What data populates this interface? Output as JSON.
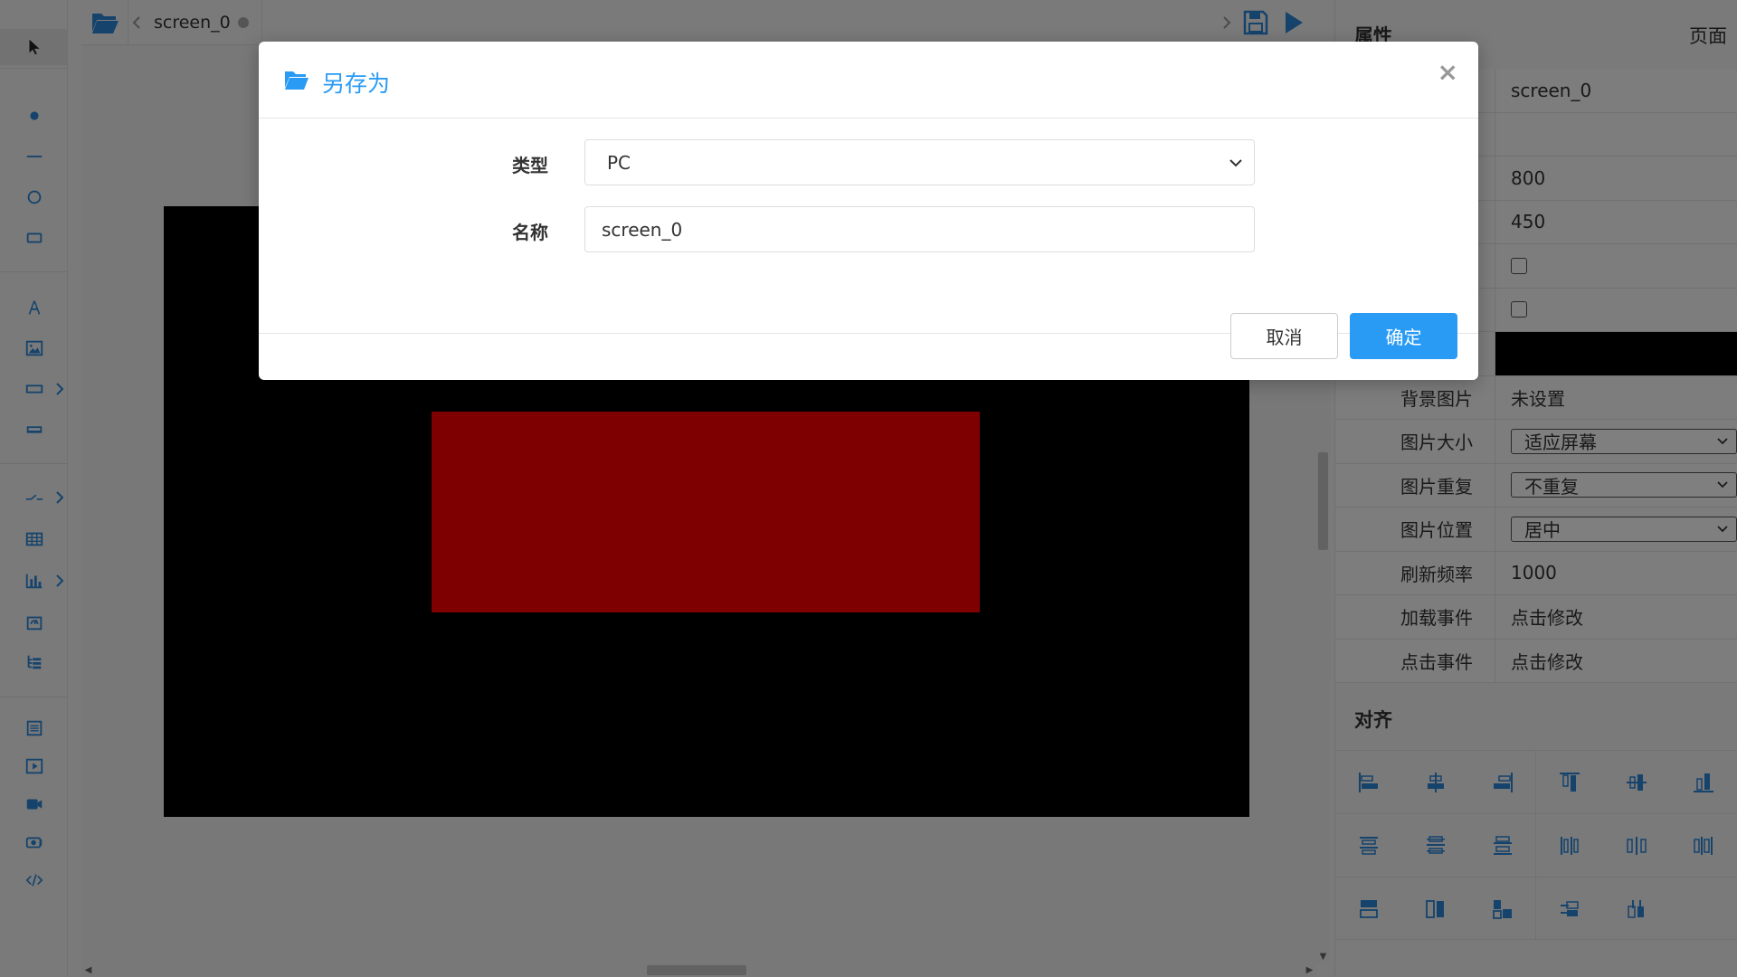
{
  "tabbar": {
    "active_tab": "screen_0"
  },
  "canvas": {
    "screen_color": "#000000",
    "rect_color": "#ff0000"
  },
  "properties": {
    "title": "属性",
    "scope": "页面",
    "rows": [
      {
        "label": "",
        "value": "screen_0"
      },
      {
        "label": "",
        "value": ""
      },
      {
        "label": "",
        "value": "800"
      },
      {
        "label": "",
        "value": "450"
      },
      {
        "label": "",
        "checkbox": true
      },
      {
        "label": "",
        "checkbox": true
      },
      {
        "label": "",
        "color": "#000000"
      },
      {
        "label": "背景图片",
        "value": "未设置"
      },
      {
        "label": "图片大小",
        "select": "适应屏幕"
      },
      {
        "label": "图片重复",
        "select": "不重复"
      },
      {
        "label": "图片位置",
        "select": "居中"
      },
      {
        "label": "刷新频率",
        "value": "1000"
      },
      {
        "label": "加载事件",
        "value": "点击修改"
      },
      {
        "label": "点击事件",
        "value": "点击修改"
      }
    ],
    "align_title": "对齐"
  },
  "dialog": {
    "title": "另存为",
    "close_symbol": "×",
    "type_label": "类型",
    "type_value": "PC",
    "name_label": "名称",
    "name_value": "screen_0",
    "cancel_label": "取消",
    "ok_label": "确定",
    "accent_color": "#2a9bf5"
  }
}
